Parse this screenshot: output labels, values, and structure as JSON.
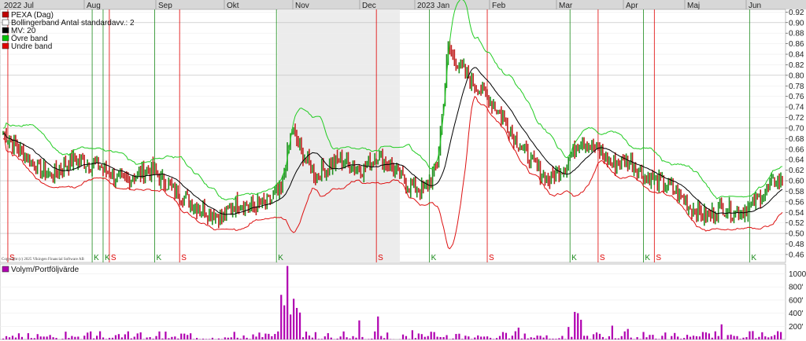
{
  "chart_data": [
    {
      "type": "ohlc-bar",
      "instrument": "PEXA (Dag)",
      "months": [
        "2022 Jul",
        "Aug",
        "Sep",
        "Okt",
        "Nov",
        "Dec",
        "2023 Jan",
        "Feb",
        "Mar",
        "Apr",
        "Maj",
        "Jun"
      ],
      "y_ticks": [
        "0.92",
        "0.90",
        "0.88",
        "0.86",
        "0.84",
        "0.82",
        "0.80",
        "0.78",
        "0.76",
        "0.74",
        "0.72",
        "0.70",
        "0.68",
        "0.66",
        "0.64",
        "0.62",
        "0.60",
        "0.58",
        "0.56",
        "0.54",
        "0.52",
        "0.50",
        "0.48",
        "0.46"
      ],
      "ylim": [
        0.445,
        0.925
      ],
      "grid": true,
      "legend": [
        {
          "label": "PEXA (Dag)",
          "color": "#c00000"
        },
        {
          "label": "Bollingerband  Antal standardavv.: 2",
          "color": "#ffffff"
        },
        {
          "label": "MV: 20",
          "color": "#000000"
        },
        {
          "label": "Övre band",
          "color": "#00c000"
        },
        {
          "label": "Undre band",
          "color": "#e00000"
        }
      ],
      "series_colors": {
        "up": "#1f8f1f",
        "down": "#c02020",
        "upper": "#22cc22",
        "lower": "#dd1111",
        "ma": "#000000"
      },
      "shaded_range": [
        "2022-11-01",
        "2022-12-31"
      ],
      "signals": [
        {
          "day": 3,
          "label": "S",
          "color": "#e00000"
        },
        {
          "day": 57,
          "label": "K",
          "color": "#1a8a1a"
        },
        {
          "day": 64,
          "label": "K",
          "color": "#1a8a1a"
        },
        {
          "day": 68,
          "label": "S",
          "color": "#e00000"
        },
        {
          "day": 97,
          "label": "K",
          "color": "#1a8a1a"
        },
        {
          "day": 113,
          "label": "S",
          "color": "#e00000"
        },
        {
          "day": 175,
          "label": "K",
          "color": "#1a8a1a"
        },
        {
          "day": 239,
          "label": "S",
          "color": "#e00000"
        },
        {
          "day": 273,
          "label": "K",
          "color": "#1a8a1a"
        },
        {
          "day": 310,
          "label": "S",
          "color": "#e00000"
        },
        {
          "day": 363,
          "label": "K",
          "color": "#1a8a1a"
        },
        {
          "day": 381,
          "label": "S",
          "color": "#e00000"
        },
        {
          "day": 410,
          "label": "K",
          "color": "#1a8a1a"
        },
        {
          "day": 417,
          "label": "S",
          "color": "#e00000"
        },
        {
          "day": 478,
          "label": "K",
          "color": "#1a8a1a"
        }
      ],
      "anchors": [
        [
          0,
          0.69
        ],
        [
          10,
          0.66
        ],
        [
          20,
          0.63
        ],
        [
          30,
          0.61
        ],
        [
          45,
          0.64
        ],
        [
          60,
          0.63
        ],
        [
          75,
          0.6
        ],
        [
          95,
          0.62
        ],
        [
          110,
          0.58
        ],
        [
          125,
          0.55
        ],
        [
          140,
          0.53
        ],
        [
          150,
          0.56
        ],
        [
          160,
          0.55
        ],
        [
          170,
          0.56
        ],
        [
          178,
          0.58
        ],
        [
          185,
          0.7
        ],
        [
          190,
          0.66
        ],
        [
          200,
          0.61
        ],
        [
          215,
          0.64
        ],
        [
          230,
          0.62
        ],
        [
          240,
          0.65
        ],
        [
          250,
          0.62
        ],
        [
          260,
          0.59
        ],
        [
          270,
          0.58
        ],
        [
          278,
          0.63
        ],
        [
          285,
          0.85
        ],
        [
          292,
          0.82
        ],
        [
          300,
          0.79
        ],
        [
          310,
          0.76
        ],
        [
          320,
          0.72
        ],
        [
          330,
          0.67
        ],
        [
          340,
          0.63
        ],
        [
          350,
          0.6
        ],
        [
          360,
          0.63
        ],
        [
          370,
          0.68
        ],
        [
          380,
          0.66
        ],
        [
          390,
          0.63
        ],
        [
          400,
          0.64
        ],
        [
          410,
          0.61
        ],
        [
          420,
          0.6
        ],
        [
          430,
          0.58
        ],
        [
          440,
          0.55
        ],
        [
          450,
          0.53
        ],
        [
          460,
          0.55
        ],
        [
          470,
          0.54
        ],
        [
          478,
          0.55
        ],
        [
          485,
          0.57
        ],
        [
          495,
          0.6
        ]
      ],
      "volume": {
        "label": "Volym/Portföljvärde",
        "color": "#b000b0",
        "y_ticks": [
          "1000'",
          "800'",
          "600'",
          "400'",
          "200'"
        ],
        "ylim": [
          0,
          1150
        ],
        "spikes": [
          [
            178,
            680
          ],
          [
            180,
            520
          ],
          [
            182,
            1120
          ],
          [
            184,
            380
          ],
          [
            186,
            620
          ],
          [
            188,
            480
          ],
          [
            190,
            410
          ],
          [
            195,
            260
          ],
          [
            205,
            320
          ],
          [
            228,
            290
          ],
          [
            240,
            350
          ],
          [
            255,
            220
          ],
          [
            262,
            140
          ],
          [
            330,
            180
          ],
          [
            345,
            240
          ],
          [
            362,
            190
          ],
          [
            366,
            420
          ],
          [
            368,
            400
          ],
          [
            370,
            300
          ],
          [
            390,
            210
          ],
          [
            400,
            160
          ],
          [
            435,
            240
          ],
          [
            445,
            210
          ],
          [
            455,
            190
          ],
          [
            460,
            230
          ]
        ]
      }
    }
  ],
  "copyright": "Copyright (c) 2025 Vikingen Financial Software AB"
}
